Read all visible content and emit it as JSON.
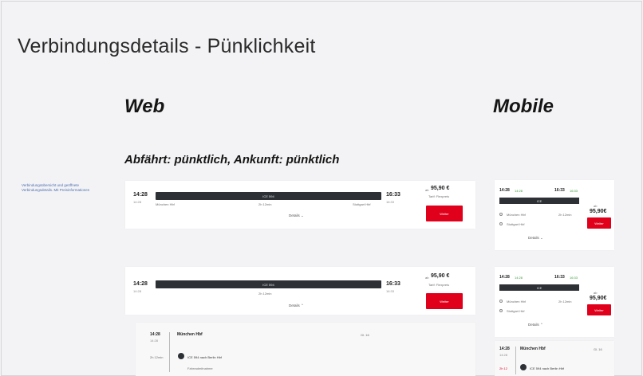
{
  "page_title": "Verbindungsdetails - Pünklichkeit",
  "sections": {
    "web": "Web",
    "mobile": "Mobile"
  },
  "subtitle": "Abfährt: pünktlich, Ankunft: pünktlich",
  "side_note": "Verbindungsübersicht und geöffnete Verbindungsdetails. Mit Preisinformationen",
  "colors": {
    "accent_red": "#e0001b",
    "bar_dark": "#2d3035",
    "background": "#f3f3f5"
  },
  "web_collapsed": {
    "dep_time": "14:28",
    "dep_sub": "14:28",
    "arr_time": "16:33",
    "arr_sub": "16:33",
    "train": "ICE 594",
    "from": "München Hbf",
    "duration": "2h 12min",
    "to": "Stuttgart Hbf",
    "price_prefix": "ab",
    "price": "95,90 €",
    "price_note": "Tarif: Flexpreis",
    "button": "Weiter",
    "details": "Details ⌄"
  },
  "web_expanded": {
    "dep_time": "14:28",
    "dep_sub": "14:28",
    "arr_time": "16:33",
    "arr_sub": "16:33",
    "train": "ICE 594",
    "duration": "2h 12min",
    "price_prefix": "ab",
    "price": "95,90 €",
    "price_note": "Tarif: Flexpreis",
    "button": "Weiter",
    "details": "Details ⌃",
    "stop_time": "14:28",
    "stop_time_sub": "14:28",
    "stop_name": "München Hbf",
    "stop_meta": "Gl. 16",
    "leg_duration": "2h 12min",
    "leg_train": "ICE 594 nach Berlin Hbf",
    "leg_extra": "Fahrradmitnahme"
  },
  "mobile_collapsed": {
    "dep_time": "14:28",
    "dep_sub": "14:28",
    "arr_time": "16:33",
    "arr_sub": "16:33",
    "train": "ICE",
    "from": "München Hbf",
    "duration": "2h 12min",
    "to": "Stuttgart Hbf",
    "price_prefix": "ab",
    "price": "95,90€",
    "button": "Weiter",
    "details": "Details ⌄"
  },
  "mobile_expanded": {
    "dep_time": "14:28",
    "dep_sub": "14:28",
    "arr_time": "16:33",
    "arr_sub": "16:33",
    "train": "ICE",
    "from": "München Hbf",
    "duration": "2h 12min",
    "to": "Stuttgart Hbf",
    "price_prefix": "ab",
    "price": "95,90€",
    "button": "Weiter",
    "details": "Details ⌃",
    "stop_time": "14:28",
    "stop_time_sub": "14:28",
    "stop_name": "München Hbf",
    "stop_meta": "Gl. 16",
    "leg_duration": "2h 12",
    "leg_train": "ICE 594 nach Berlin Hbf"
  }
}
